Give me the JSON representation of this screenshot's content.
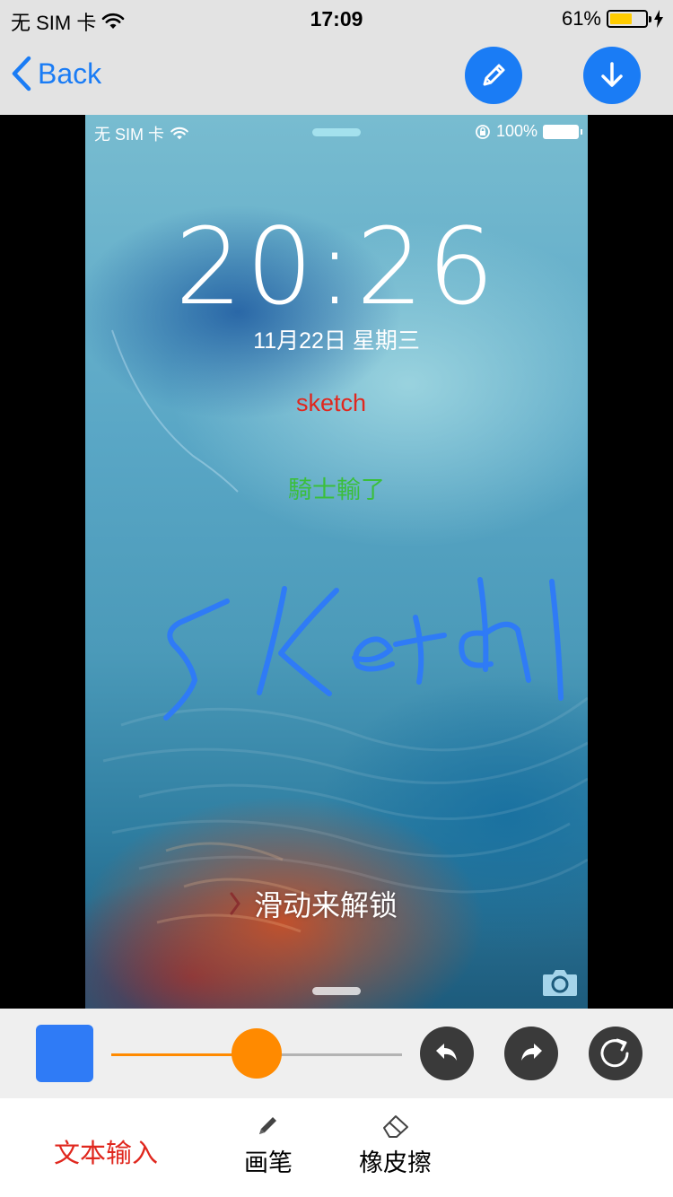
{
  "status_bar": {
    "carrier": "无 SIM 卡",
    "time": "17:09",
    "battery_percent": "61%",
    "battery_level": 0.61,
    "battery_color": "#ffcc00"
  },
  "nav": {
    "back_label": "Back",
    "edit_icon": "pencil-icon",
    "download_icon": "download-arrow-icon",
    "accent_color": "#1a7cf5"
  },
  "screenshot": {
    "status": {
      "carrier": "无 SIM 卡",
      "battery_percent": "100%"
    },
    "clock": "20:26",
    "date": "11月22日 星期三",
    "text_annotation_red": "sketch",
    "text_annotation_green": "騎士輸了",
    "handwriting_color": "#2f7bf6",
    "unlock_hint": "滑动来解锁"
  },
  "toolbar": {
    "selected_color": "#2f7bf6",
    "brush_size_level": 0.5,
    "slider_color": "#ff8a00",
    "undo_icon": "undo-icon",
    "redo_icon": "redo-icon",
    "reset_icon": "refresh-icon"
  },
  "tabs": {
    "text_input_label": "文本输入",
    "brush_label": "画笔",
    "eraser_label": "橡皮擦"
  }
}
